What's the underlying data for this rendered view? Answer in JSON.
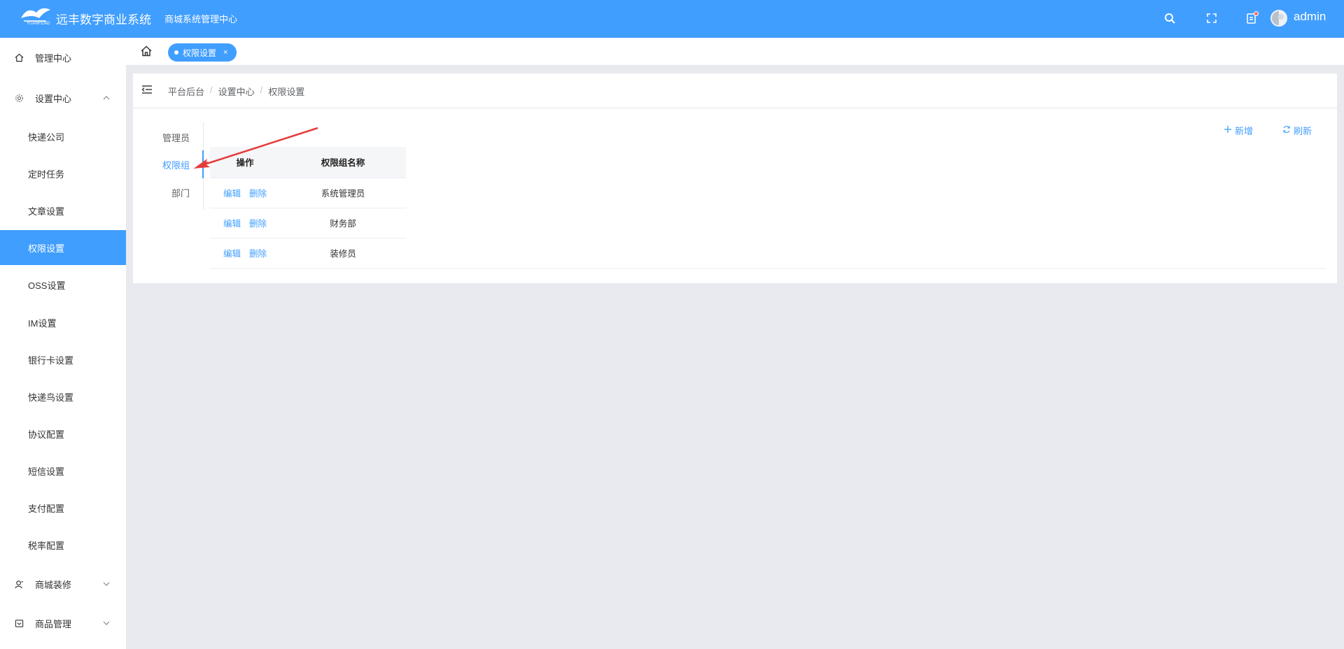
{
  "header": {
    "logo_text": "YUANFENG",
    "brand_name": "远丰数字商业系统",
    "system_title": "商城系统管理中心",
    "username": "admin",
    "icons": [
      "search-icon",
      "fullscreen-icon",
      "notification-icon"
    ],
    "bg_color": "#409eff"
  },
  "sidebar": {
    "items": [
      {
        "label": "管理中心",
        "icon": "home-icon"
      },
      {
        "label": "设置中心",
        "icon": "settings-icon",
        "expanded": true
      },
      {
        "label": "商城装修",
        "icon": "decoration-icon",
        "expanded": false
      },
      {
        "label": "商品管理",
        "icon": "goods-icon",
        "expanded": false
      }
    ],
    "settings_children": [
      "快递公司",
      "定时任务",
      "文章设置",
      "权限设置",
      "OSS设置",
      "IM设置",
      "银行卡设置",
      "快递鸟设置",
      "协议配置",
      "短信设置",
      "支付配置",
      "税率配置"
    ],
    "active_child": "权限设置",
    "active_color": "#409eff"
  },
  "tags": {
    "home_icon": "home-icon",
    "items": [
      {
        "label": "权限设置",
        "close": "×"
      }
    ]
  },
  "breadcrumb": [
    "平台后台",
    "设置中心",
    "权限设置"
  ],
  "tabs": {
    "items": [
      "管理员",
      "权限组",
      "部门"
    ],
    "active": "权限组"
  },
  "actions": {
    "add_label": "新增",
    "refresh_label": "刷新"
  },
  "table": {
    "columns": [
      "操作",
      "权限组名称"
    ],
    "rows": [
      {
        "edit": "编辑",
        "delete": "删除",
        "name": "系统管理员"
      },
      {
        "edit": "编辑",
        "delete": "删除",
        "name": "财务部"
      },
      {
        "edit": "编辑",
        "delete": "删除",
        "name": "装修员"
      }
    ]
  }
}
